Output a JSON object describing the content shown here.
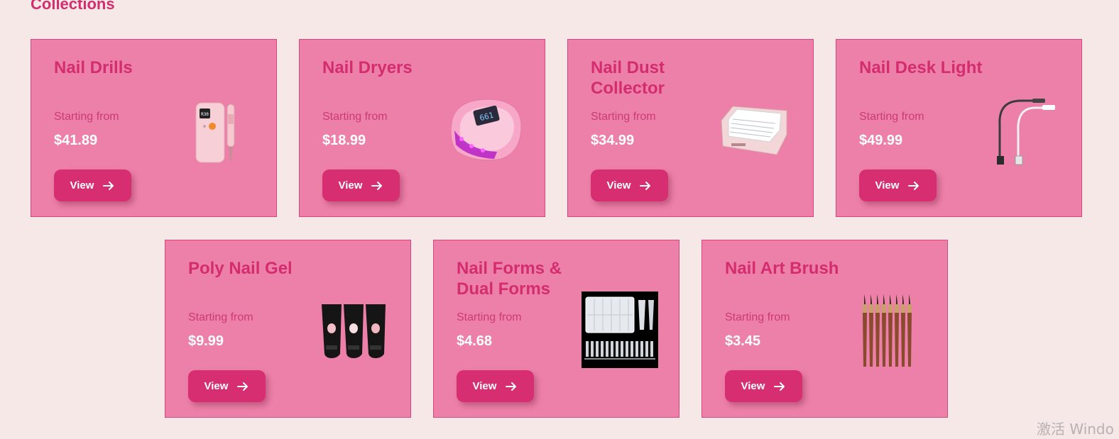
{
  "section": {
    "title": "Collections"
  },
  "cards": [
    {
      "title": "Nail Drills",
      "starting_label": "Starting from",
      "price": "$41.89",
      "button_label": "View",
      "icon": "nail-drill-icon"
    },
    {
      "title": "Nail Dryers",
      "starting_label": "Starting from",
      "price": "$18.99",
      "button_label": "View",
      "icon": "uv-lamp-icon"
    },
    {
      "title": "Nail Dust Collector",
      "starting_label": "Starting from",
      "price": "$34.99",
      "button_label": "View",
      "icon": "dust-collector-icon"
    },
    {
      "title": "Nail Desk Light",
      "starting_label": "Starting from",
      "price": "$49.99",
      "button_label": "View",
      "icon": "desk-lamp-icon"
    },
    {
      "title": "Poly Nail Gel",
      "starting_label": "Starting from",
      "price": "$9.99",
      "button_label": "View",
      "icon": "gel-tubes-icon"
    },
    {
      "title": "Nail Forms & Dual Forms",
      "starting_label": "Starting from",
      "price": "$4.68",
      "button_label": "View",
      "icon": "nail-forms-icon"
    },
    {
      "title": "Nail Art Brush",
      "starting_label": "Starting from",
      "price": "$3.45",
      "button_label": "View",
      "icon": "brush-set-icon"
    }
  ],
  "watermark": {
    "text": "激活 Windo"
  },
  "colors": {
    "page_bg": "#f5e8e6",
    "card_bg": "#ec80a8",
    "accent": "#d42d6f",
    "button_bg": "#d62e70"
  }
}
